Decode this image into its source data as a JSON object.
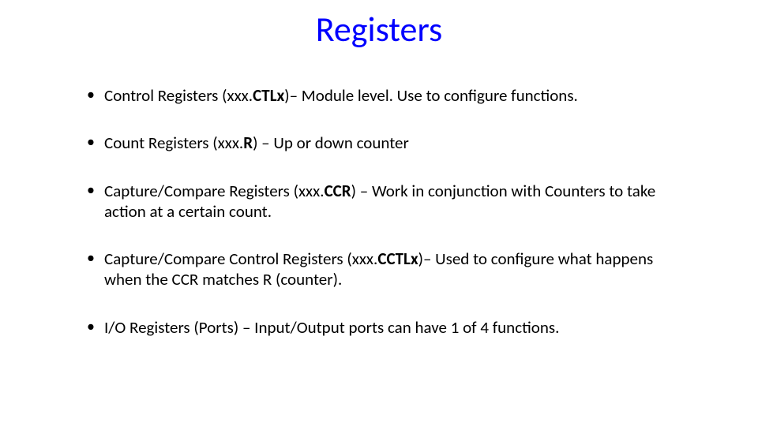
{
  "title": "Registers",
  "bullets": [
    {
      "pre": "Control Registers (xxx.",
      "bold": "CTLx",
      "post": ")– Module level. Use to configure functions."
    },
    {
      "pre": "Count Registers (xxx.",
      "bold": "R",
      "post": ") – Up or down counter"
    },
    {
      "pre": "Capture/Compare Registers (xxx.",
      "bold": "CCR",
      "post": ") – Work in conjunction with Counters to take action at a certain count."
    },
    {
      "pre": "Capture/Compare Control Registers (xxx.",
      "bold": "CCTLx",
      "post": ")– Used to configure what happens when the CCR matches R (counter)."
    },
    {
      "pre": "I/O Registers (Ports) – Input/Output ports can have 1 of 4 functions.",
      "bold": "",
      "post": ""
    }
  ]
}
